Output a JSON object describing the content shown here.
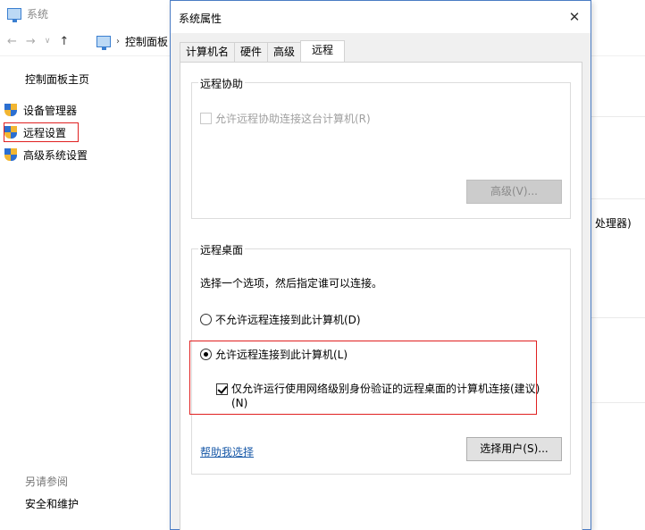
{
  "background_window": {
    "title": "系统",
    "address_breadcrumb": "控制面板",
    "left_nav": {
      "home": "控制面板主页",
      "items": [
        {
          "label": "设备管理器"
        },
        {
          "label": "远程设置"
        },
        {
          "label": "高级系统设置"
        }
      ],
      "see_also_heading": "另请参阅",
      "see_also_items": [
        "安全和维护"
      ]
    },
    "right_fragment": "处理器)"
  },
  "dialog": {
    "title": "系统属性",
    "close_glyph": "✕",
    "tabs": [
      {
        "label": "计算机名",
        "active": false
      },
      {
        "label": "硬件",
        "active": false
      },
      {
        "label": "高级",
        "active": false
      },
      {
        "label": "远程",
        "active": true
      }
    ],
    "remote_assistance": {
      "group_label": "远程协助",
      "allow_checkbox_label": "允许远程协助连接这台计算机(R)",
      "allow_checked": false,
      "allow_enabled": false,
      "advanced_button": "高级(V)..."
    },
    "remote_desktop": {
      "group_label": "远程桌面",
      "instruction": "选择一个选项，然后指定谁可以连接。",
      "options": [
        {
          "label": "不允许远程连接到此计算机(D)",
          "selected": false
        },
        {
          "label": "允许远程连接到此计算机(L)",
          "selected": true
        }
      ],
      "nla_checkbox_line1": "仅允许运行使用网络级别身份验证的远程桌面的计算机连接(建议)",
      "nla_checkbox_line2": "(N)",
      "nla_checked": true,
      "help_link": "帮助我选择",
      "select_users_button": "选择用户(S)..."
    }
  },
  "colors": {
    "highlight_border": "#e02020",
    "dialog_border": "#4a7cc4",
    "link": "#1a5aa8"
  }
}
